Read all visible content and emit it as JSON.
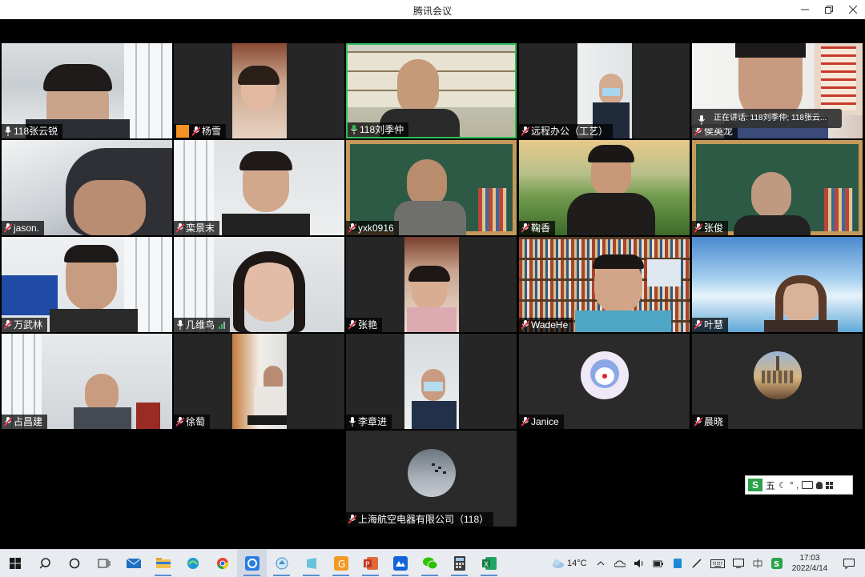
{
  "window": {
    "title": "腾讯会议"
  },
  "speaking_banner": "正在讲话: 118刘季仲; 118张云...",
  "participants": [
    {
      "name": "118张云锐",
      "mic": "on"
    },
    {
      "name": "杨雪",
      "mic": "muted"
    },
    {
      "name": "118刘季仲",
      "mic": "on"
    },
    {
      "name": "远程办公（工艺）",
      "mic": "muted"
    },
    {
      "name": "侯英龙",
      "mic": "muted"
    },
    {
      "name": "jason.",
      "mic": "muted"
    },
    {
      "name": "栾景末",
      "mic": "muted"
    },
    {
      "name": "yxk0916",
      "mic": "muted"
    },
    {
      "name": "鞠香",
      "mic": "muted"
    },
    {
      "name": "张俊",
      "mic": "muted"
    },
    {
      "name": "万武林",
      "mic": "muted"
    },
    {
      "name": "几维鸟",
      "mic": "on"
    },
    {
      "name": "张艳",
      "mic": "muted"
    },
    {
      "name": "WadeHe",
      "mic": "muted"
    },
    {
      "name": "叶慧",
      "mic": "muted"
    },
    {
      "name": "占昌建",
      "mic": "muted"
    },
    {
      "name": "徐萄",
      "mic": "muted"
    },
    {
      "name": "李章进",
      "mic": "on"
    },
    {
      "name": "Janice",
      "mic": "muted"
    },
    {
      "name": "晨晓",
      "mic": "muted"
    },
    {
      "name": "上海航空电器有限公司（118）",
      "mic": "muted"
    }
  ],
  "ime": {
    "mode": "五",
    "symbols": "° ,"
  },
  "taskbar": {
    "apps": [
      "start-icon",
      "search-icon",
      "cortana-icon",
      "task-view-icon",
      "mail-icon",
      "file-explorer-icon",
      "edge-icon",
      "chrome-icon",
      "tencent-meeting-icon",
      "media-icon",
      "notes-icon",
      "image-viewer-icon",
      "powerpoint-icon",
      "app-icon",
      "wechat-icon",
      "calculator-icon",
      "excel-icon"
    ],
    "weather": "14°C",
    "time": "17:03",
    "date": "2022/4/14"
  },
  "colors": {
    "muted_mic": "#e0394a",
    "active_mic": "#2fbf5b",
    "accent": "#5a8fd0"
  }
}
